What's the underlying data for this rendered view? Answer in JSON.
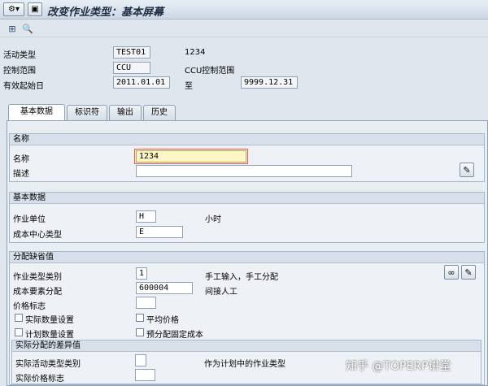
{
  "title": "改变作业类型：基本屏幕",
  "header": {
    "activity_type_label": "活动类型",
    "activity_type_value": "TEST01",
    "activity_type_desc": "1234",
    "controlling_area_label": "控制范围",
    "controlling_area_value": "CCU",
    "controlling_area_desc": "CCU控制范围",
    "valid_from_label": "有效起始日",
    "valid_from_value": "2011.01.01",
    "to_label": "至",
    "valid_to_value": "9999.12.31"
  },
  "tabs": [
    {
      "label": "基本数据"
    },
    {
      "label": "标识符"
    },
    {
      "label": "输出"
    },
    {
      "label": "历史"
    }
  ],
  "names_group": {
    "title": "名称",
    "name_label": "名称",
    "name_value": "1234",
    "desc_label": "描述",
    "desc_value": ""
  },
  "basic_group": {
    "title": "基本数据",
    "unit_label": "作业单位",
    "unit_value": "H",
    "unit_desc": "小时",
    "cc_category_label": "成本中心类型",
    "cc_category_value": "E"
  },
  "defaults_group": {
    "title": "分配缺省值",
    "at_category_label": "作业类型类别",
    "at_category_value": "1",
    "at_category_desc": "手工输入，手工分配",
    "cost_element_label": "成本要素分配",
    "cost_element_value": "600004",
    "cost_element_desc": "间接人工",
    "price_indicator_label": "价格标志",
    "price_indicator_value": "",
    "actual_qty_label": "实际数量设置",
    "avg_price_label": "平均价格",
    "plan_qty_label": "计划数量设置",
    "predist_fixed_label": "预分配固定成本"
  },
  "variance_group": {
    "title": "实际分配的差异值",
    "actual_at_category_label": "实际活动类型类别",
    "actual_at_category_value": "",
    "actual_at_category_desc": "作为计划中的作业类型",
    "actual_price_label": "实际价格标志",
    "actual_price_value": ""
  },
  "watermark": "知乎 @TOPERP讲堂"
}
